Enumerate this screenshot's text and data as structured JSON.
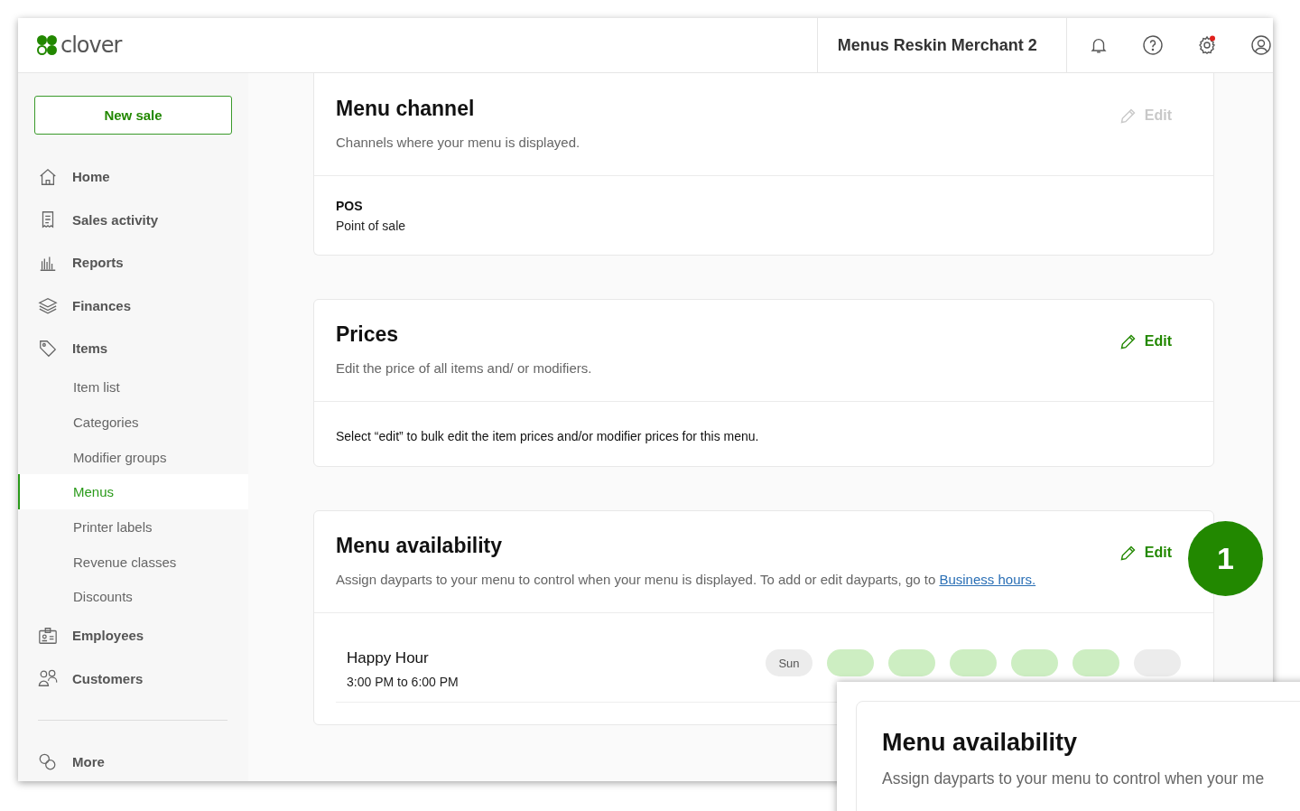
{
  "header": {
    "brand": "clover",
    "merchant": "Menus Reskin Merchant 2",
    "settings_alert": true
  },
  "sidebar": {
    "new_sale": "New sale",
    "items": [
      {
        "label": "Home",
        "selected": false
      },
      {
        "label": "Sales activity",
        "selected": false
      },
      {
        "label": "Reports",
        "selected": false
      },
      {
        "label": "Finances",
        "selected": false
      },
      {
        "label": "Items",
        "selected": false,
        "children": [
          {
            "label": "Item list",
            "selected": false
          },
          {
            "label": "Categories",
            "selected": false
          },
          {
            "label": "Modifier groups",
            "selected": false
          },
          {
            "label": "Menus",
            "selected": true
          },
          {
            "label": "Printer labels",
            "selected": false
          },
          {
            "label": "Revenue classes",
            "selected": false
          },
          {
            "label": "Discounts",
            "selected": false
          }
        ]
      },
      {
        "label": "Employees",
        "selected": false
      },
      {
        "label": "Customers",
        "selected": false
      }
    ],
    "footer_item": {
      "label": "More",
      "selected": false
    }
  },
  "cards": [
    {
      "title": "Menu channel",
      "description": "Channels where your menu is displayed.",
      "edit": {
        "label": "Edit",
        "disabled": true
      },
      "kind": "channel",
      "channel": {
        "name": "POS",
        "detail": "Point of sale"
      }
    },
    {
      "title": "Prices",
      "description": "Edit the price of all items and/ or modifiers.",
      "edit": {
        "label": "Edit",
        "disabled": false
      },
      "kind": "note",
      "note": "Select “edit” to bulk edit the item prices and/or modifier prices for this menu."
    },
    {
      "title": "Menu availability",
      "description": "Assign dayparts to your menu to control when your menu is displayed. To add or edit dayparts, go to ",
      "link": "Business hours.",
      "edit": {
        "label": "Edit",
        "disabled": false
      },
      "kind": "dayparts",
      "daypart": {
        "name": "Happy Hour",
        "time": "3:00 PM to 6:00 PM",
        "days": [
          {
            "label": "Sun",
            "selected": false
          },
          {
            "selected": true
          },
          {
            "selected": true
          },
          {
            "selected": true
          },
          {
            "selected": true
          },
          {
            "selected": true
          },
          {
            "selected": false
          }
        ]
      }
    }
  ],
  "step_badge": "1",
  "zoom_callout": {
    "title": "Menu availability",
    "description": "Assign dayparts to your menu to control when your me"
  }
}
